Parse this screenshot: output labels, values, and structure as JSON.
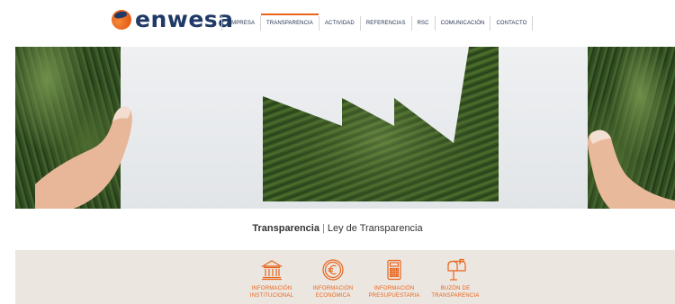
{
  "brand": {
    "name": "enwesa"
  },
  "nav": {
    "items": [
      {
        "label": "EMPRESA",
        "active": false
      },
      {
        "label": "TRANSPARENCIA",
        "active": true
      },
      {
        "label": "ACTIVIDAD",
        "active": false
      },
      {
        "label": "REFERENCIAS",
        "active": false
      },
      {
        "label": "RSC",
        "active": false
      },
      {
        "label": "COMUNICACIÓN",
        "active": false
      },
      {
        "label": "CONTACTO",
        "active": false
      }
    ]
  },
  "breadcrumb": {
    "current": "Transparencia",
    "separator": "|",
    "page": "Ley de Transparencia"
  },
  "sections": {
    "items": [
      {
        "line1": "INFORMACIÓN",
        "line2": "INSTITUCIONAL",
        "icon": "institution-building-icon"
      },
      {
        "line1": "INFORMACIÓN",
        "line2": "ECONÓMICA",
        "icon": "euro-coin-icon"
      },
      {
        "line1": "INFORMACIÓN",
        "line2": "PRESUPUESTARIA",
        "icon": "calculator-icon"
      },
      {
        "line1": "BUZÓN DE",
        "line2": "TRANSPARENCIA",
        "icon": "mailbox-icon"
      }
    ]
  },
  "colors": {
    "accent": "#e8641b",
    "brand_navy": "#1f3a66",
    "strip_bg": "#ece6e0"
  }
}
